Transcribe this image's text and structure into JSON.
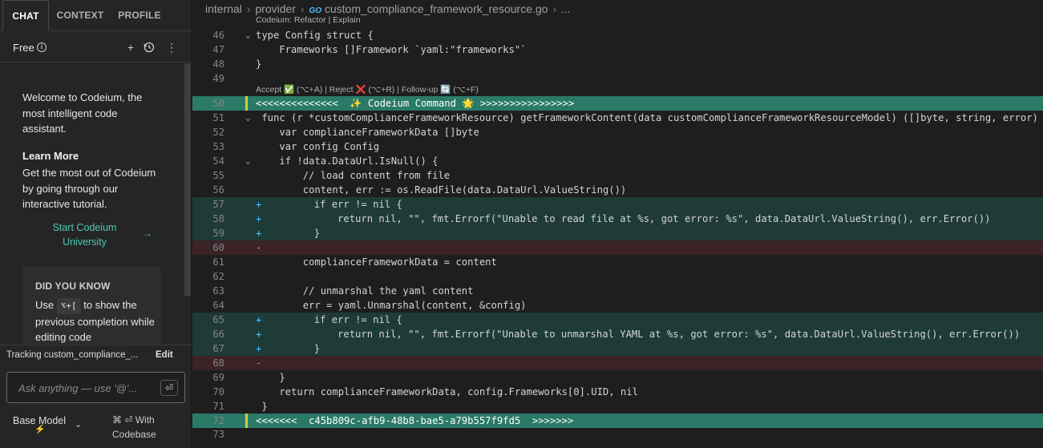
{
  "sidebar": {
    "tabs": [
      {
        "label": "CHAT",
        "active": true
      },
      {
        "label": "CONTEXT",
        "active": false
      },
      {
        "label": "PROFILE",
        "active": false
      }
    ],
    "plan_label": "Free",
    "icons": [
      "info-icon",
      "plus-icon",
      "history-icon",
      "more-icon"
    ],
    "welcome_text": "Welcome to Codeium, the most intelligent code assistant.",
    "learn_title": "Learn More",
    "learn_body": "Get the most out of Codeium by going through our interactive tutorial.",
    "start_link": "Start Codeium University",
    "did_you_know": {
      "title": "DID YOU KNOW",
      "before": "Use",
      "key": "⌥+[",
      "after": "to show the previous completion while editing code"
    },
    "tracking_text": "Tracking custom_compliance_...",
    "edit_label": "Edit",
    "ask_placeholder": "Ask anything — use '@'...",
    "model_label": "Base Model",
    "codebase_label": "⌘ ⏎ With Codebase"
  },
  "editor": {
    "breadcrumb": [
      "internal",
      "provider",
      "custom_compliance_framework_resource.go",
      "..."
    ],
    "lens_top": "Codeium: Refactor | Explain",
    "lens_accept": "Accept ✅ (⌥+A) | Reject ❌ (⌥+R) | Follow-up 🔄 (⌥+F)",
    "lines": [
      {
        "n": "46",
        "text": "type Config struct {",
        "fold": "⌄"
      },
      {
        "n": "47",
        "text": "    Frameworks []Framework `yaml:\"frameworks\"`"
      },
      {
        "n": "48",
        "text": "}"
      },
      {
        "n": "49",
        "text": ""
      },
      {
        "n": "50",
        "text": "<<<<<<<<<<<<<<  ✨ Codeium Command 🌟 >>>>>>>>>>>>>>>>",
        "type": "marker"
      },
      {
        "n": "51",
        "text": " func (r *customComplianceFrameworkResource) getFrameworkContent(data customComplianceFrameworkResourceModel) ([]byte, string, error) {",
        "fold": "⌄"
      },
      {
        "n": "52",
        "text": "    var complianceFrameworkData []byte"
      },
      {
        "n": "53",
        "text": "    var config Config"
      },
      {
        "n": "54",
        "text": "    if !data.DataUrl.IsNull() {",
        "fold": "⌄"
      },
      {
        "n": "55",
        "text": "        // load content from file"
      },
      {
        "n": "56",
        "text": "        content, err := os.ReadFile(data.DataUrl.ValueString())"
      },
      {
        "n": "57",
        "text": "        if err != nil {",
        "type": "added",
        "sign": "+"
      },
      {
        "n": "58",
        "text": "            return nil, \"\", fmt.Errorf(\"Unable to read file at %s, got error: %s\", data.DataUrl.ValueString(), err.Error())",
        "type": "added",
        "sign": "+"
      },
      {
        "n": "59",
        "text": "        }",
        "type": "added",
        "sign": "+"
      },
      {
        "n": "60",
        "text": "",
        "type": "removed",
        "sign": "-"
      },
      {
        "n": "61",
        "text": "        complianceFrameworkData = content"
      },
      {
        "n": "62",
        "text": ""
      },
      {
        "n": "63",
        "text": "        // unmarshal the yaml content"
      },
      {
        "n": "64",
        "text": "        err = yaml.Unmarshal(content, &config)"
      },
      {
        "n": "65",
        "text": "        if err != nil {",
        "type": "added",
        "sign": "+"
      },
      {
        "n": "66",
        "text": "            return nil, \"\", fmt.Errorf(\"Unable to unmarshal YAML at %s, got error: %s\", data.DataUrl.ValueString(), err.Error())",
        "type": "added",
        "sign": "+"
      },
      {
        "n": "67",
        "text": "        }",
        "type": "added",
        "sign": "+"
      },
      {
        "n": "68",
        "text": "",
        "type": "removed",
        "sign": "-"
      },
      {
        "n": "69",
        "text": "    }"
      },
      {
        "n": "70",
        "text": "    return complianceFrameworkData, config.Frameworks[0].UID, nil"
      },
      {
        "n": "71",
        "text": " }"
      },
      {
        "n": "72",
        "text": "<<<<<<<  c45b809c-afb9-48b8-bae5-a79b557f9fd5  >>>>>>>",
        "type": "marker"
      },
      {
        "n": "73",
        "text": ""
      }
    ]
  },
  "colors": {
    "accent": "#4ec9b0",
    "added_bg": "#1e3b38",
    "removed_bg": "#3b2328",
    "marker_bg": "#2b7a68"
  }
}
